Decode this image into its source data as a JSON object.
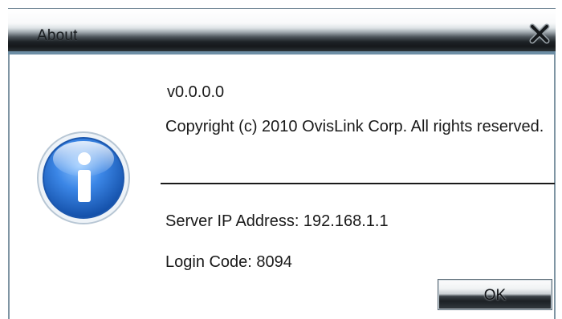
{
  "window": {
    "title": "About",
    "close_icon": "close-x-icon"
  },
  "content": {
    "icon": "info-icon",
    "version": "v0.0.0.0",
    "copyright": "Copyright (c) 2010 OvisLink Corp. All rights reserved.",
    "server_ip": "Server IP Address: 192.168.1.1",
    "login_code": "Login Code: 8094"
  },
  "buttons": {
    "ok_label": "OK"
  },
  "colors": {
    "titlebar_dark": "#1b1f22",
    "accent_blue": "#2f6fd0",
    "border": "#7f95a3"
  }
}
